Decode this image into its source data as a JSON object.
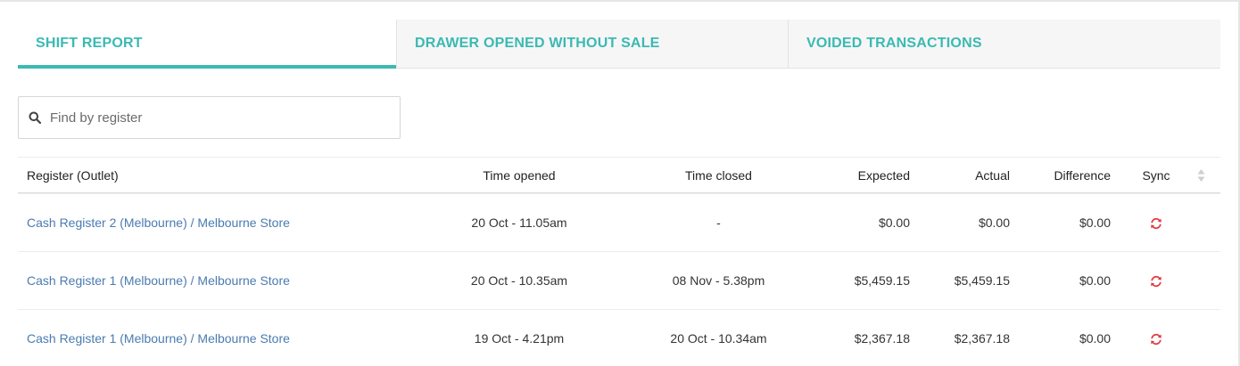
{
  "tabs": [
    {
      "label": "SHIFT REPORT",
      "active": true
    },
    {
      "label": "DRAWER OPENED WITHOUT SALE",
      "active": false
    },
    {
      "label": "VOIDED TRANSACTIONS",
      "active": false
    }
  ],
  "search": {
    "placeholder": "Find by register",
    "value": "",
    "icon": "search-icon"
  },
  "table": {
    "headers": {
      "register": "Register (Outlet)",
      "time_opened": "Time opened",
      "time_closed": "Time closed",
      "expected": "Expected",
      "actual": "Actual",
      "difference": "Difference",
      "sync": "Sync"
    },
    "rows": [
      {
        "register": "Cash Register 2 (Melbourne) / Melbourne Store",
        "time_opened": "20 Oct - 11.05am",
        "time_closed": "-",
        "expected": "$0.00",
        "actual": "$0.00",
        "difference": "$0.00"
      },
      {
        "register": "Cash Register 1 (Melbourne) / Melbourne Store",
        "time_opened": "20 Oct - 10.35am",
        "time_closed": "08 Nov - 5.38pm",
        "expected": "$5,459.15",
        "actual": "$5,459.15",
        "difference": "$0.00"
      },
      {
        "register": "Cash Register 1 (Melbourne) / Melbourne Store",
        "time_opened": "19 Oct - 4.21pm",
        "time_closed": "20 Oct - 10.34am",
        "expected": "$2,367.18",
        "actual": "$2,367.18",
        "difference": "$0.00"
      }
    ]
  },
  "colors": {
    "accent": "#3bb9b3",
    "link": "#4a7bb0",
    "sync": "#e0393e"
  }
}
